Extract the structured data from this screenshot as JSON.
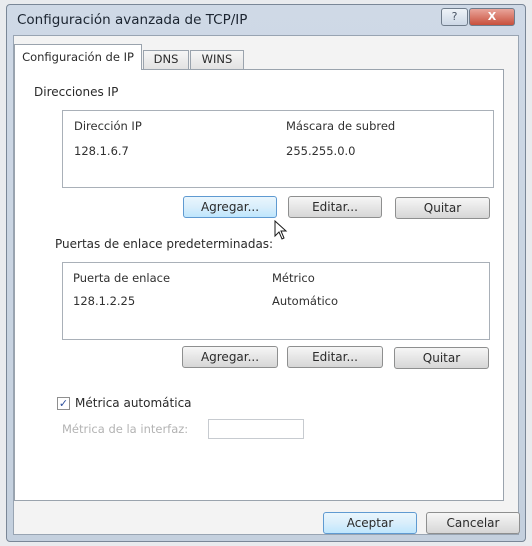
{
  "window": {
    "title": "Configuración avanzada de TCP/IP",
    "help_glyph": "?",
    "close_glyph": "X"
  },
  "tabs": [
    {
      "label": "Configuración de IP",
      "active": true
    },
    {
      "label": "DNS",
      "active": false
    },
    {
      "label": "WINS",
      "active": false
    }
  ],
  "ip_section": {
    "title": "Direcciones IP",
    "columns": [
      "Dirección IP",
      "Máscara de subred"
    ],
    "rows": [
      [
        "128.1.6.7",
        "255.255.0.0"
      ]
    ],
    "buttons": {
      "add": "Agregar...",
      "edit": "Editar...",
      "remove": "Quitar"
    }
  },
  "gateway_section": {
    "title": "Puertas de enlace predeterminadas:",
    "columns": [
      "Puerta de enlace",
      "Métrico"
    ],
    "rows": [
      [
        "128.1.2.25",
        "Automático"
      ]
    ],
    "buttons": {
      "add": "Agregar...",
      "edit": "Editar...",
      "remove": "Quitar"
    }
  },
  "metric": {
    "auto_label": "Métrica automática",
    "auto_checked": true,
    "check_glyph": "✓",
    "interface_label": "Métrica de la interfaz:",
    "interface_value": ""
  },
  "footer": {
    "ok": "Aceptar",
    "cancel": "Cancelar"
  },
  "icons": {
    "cursor": "mouse-pointer-icon"
  }
}
